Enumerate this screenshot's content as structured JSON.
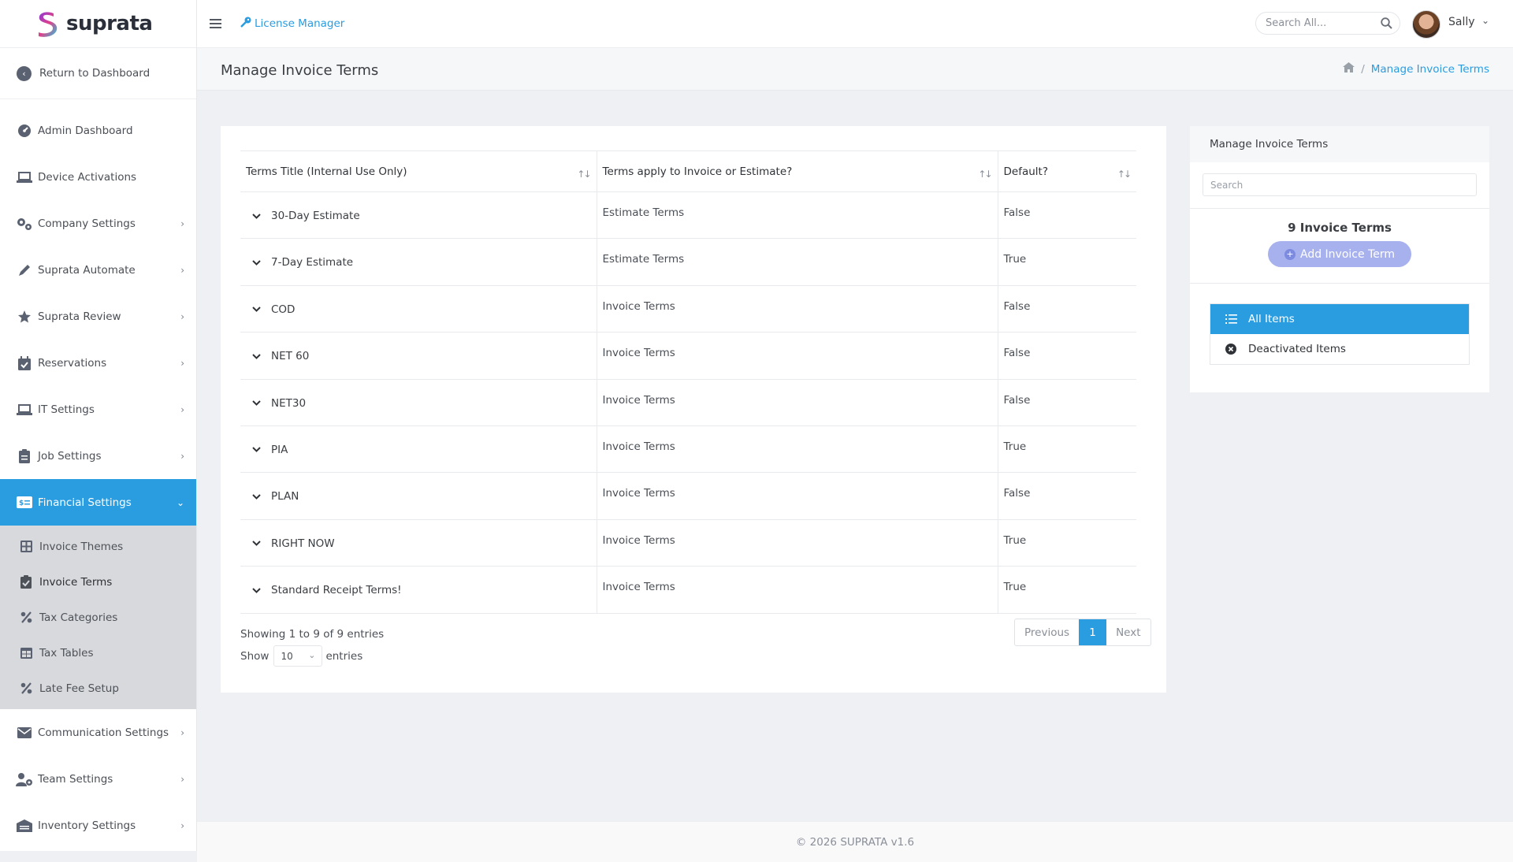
{
  "brand": {
    "name": "suprata",
    "accent": "#2a9de0"
  },
  "sidebar": {
    "return_label": "Return to Dashboard",
    "items": [
      {
        "label": "Admin Dashboard",
        "icon": "gauge-icon",
        "has_chevron": false
      },
      {
        "label": "Device Activations",
        "icon": "laptop-icon",
        "has_chevron": false
      },
      {
        "label": "Company Settings",
        "icon": "gears-icon",
        "has_chevron": true
      },
      {
        "label": "Suprata Automate",
        "icon": "pen-icon",
        "has_chevron": true
      },
      {
        "label": "Suprata Review",
        "icon": "star-icon",
        "has_chevron": true
      },
      {
        "label": "Reservations",
        "icon": "calendar-check-icon",
        "has_chevron": true
      },
      {
        "label": "IT Settings",
        "icon": "laptop-icon",
        "has_chevron": true
      },
      {
        "label": "Job Settings",
        "icon": "clipboard-icon",
        "has_chevron": true
      },
      {
        "label": "Financial Settings",
        "icon": "money-card-icon",
        "has_chevron": true,
        "active": true
      }
    ],
    "sub_items": [
      {
        "label": "Invoice Themes",
        "icon": "grid-icon"
      },
      {
        "label": "Invoice Terms",
        "icon": "clipboard-check-icon",
        "current": true
      },
      {
        "label": "Tax Categories",
        "icon": "percent-icon"
      },
      {
        "label": "Tax Tables",
        "icon": "table-icon"
      },
      {
        "label": "Late Fee Setup",
        "icon": "percent-icon"
      }
    ],
    "items_after": [
      {
        "label": "Communication Settings",
        "icon": "envelope-icon",
        "has_chevron": true
      },
      {
        "label": "Team Settings",
        "icon": "user-gear-icon",
        "has_chevron": true
      },
      {
        "label": "Inventory Settings",
        "icon": "warehouse-icon",
        "has_chevron": true
      }
    ]
  },
  "topbar": {
    "license_label": "License Manager",
    "search_placeholder": "Search All...",
    "user_name": "Sally"
  },
  "page": {
    "title": "Manage Invoice Terms",
    "breadcrumb_current": "Manage Invoice Terms"
  },
  "table": {
    "columns": [
      "Terms Title (Internal Use Only)",
      "Terms apply to Invoice or Estimate?",
      "Default?"
    ],
    "rows": [
      {
        "title": "30-Day Estimate",
        "applies": "Estimate Terms",
        "default": "False"
      },
      {
        "title": "7-Day Estimate",
        "applies": "Estimate Terms",
        "default": "True"
      },
      {
        "title": "COD",
        "applies": "Invoice Terms",
        "default": "False"
      },
      {
        "title": "NET 60",
        "applies": "Invoice Terms",
        "default": "False"
      },
      {
        "title": "NET30",
        "applies": "Invoice Terms",
        "default": "False"
      },
      {
        "title": "PIA",
        "applies": "Invoice Terms",
        "default": "True"
      },
      {
        "title": "PLAN",
        "applies": "Invoice Terms",
        "default": "False"
      },
      {
        "title": "RIGHT NOW",
        "applies": "Invoice Terms",
        "default": "True"
      },
      {
        "title": "Standard Receipt Terms!",
        "applies": "Invoice Terms",
        "default": "True"
      }
    ],
    "showing_text": "Showing 1 to 9 of 9 entries",
    "show_label": "Show",
    "page_length": "10",
    "entries_label": "entries",
    "pagination": {
      "previous": "Previous",
      "current": "1",
      "next": "Next"
    }
  },
  "right_panel": {
    "heading": "Manage Invoice Terms",
    "search_placeholder": "Search",
    "count_text": "9 Invoice Terms",
    "add_button": "Add Invoice Term",
    "filters": [
      {
        "label": "All Items",
        "icon": "list-icon",
        "active": true
      },
      {
        "label": "Deactivated Items",
        "icon": "x-circle-icon",
        "active": false
      }
    ]
  },
  "footer": {
    "text": "© 2026 SUPRATA v1.6"
  }
}
